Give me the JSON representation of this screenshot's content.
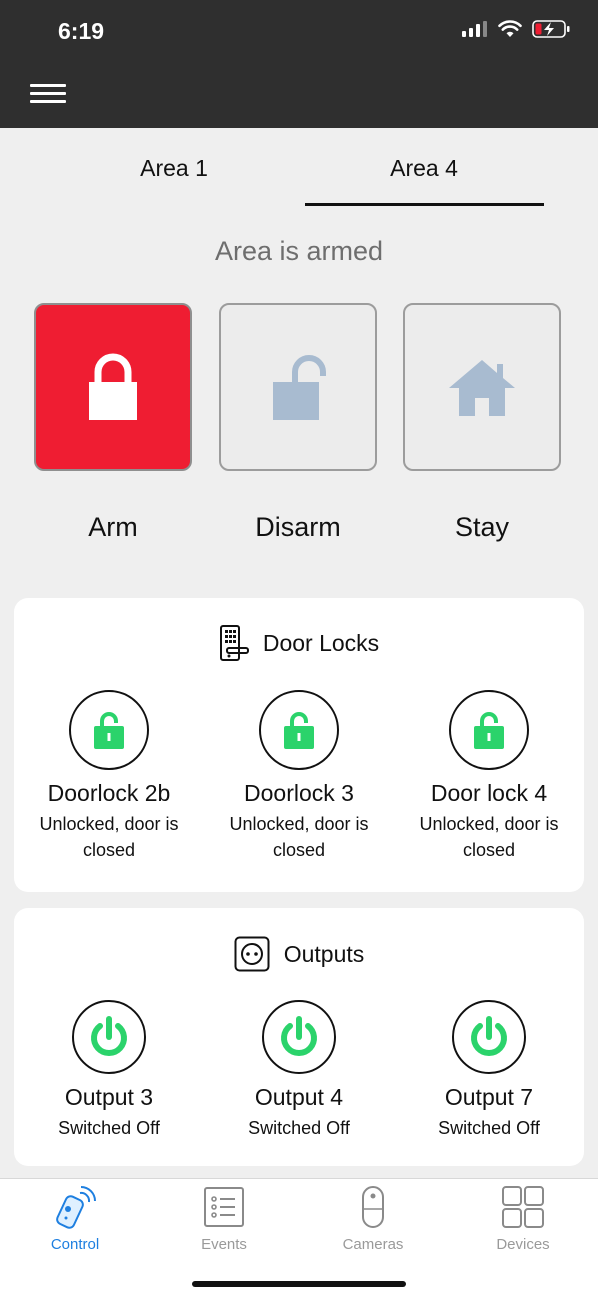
{
  "status_bar": {
    "time": "6:19"
  },
  "tabs": [
    {
      "label": "Area 1",
      "selected": false
    },
    {
      "label": "Area 4",
      "selected": true
    }
  ],
  "area_status": "Area is armed",
  "modes": [
    {
      "label": "Arm",
      "icon": "locked-padlock-icon",
      "active": true
    },
    {
      "label": "Disarm",
      "icon": "unlocked-padlock-icon",
      "active": false
    },
    {
      "label": "Stay",
      "icon": "house-icon",
      "active": false
    }
  ],
  "door_locks": {
    "title": "Door Locks",
    "items": [
      {
        "name": "Doorlock 2b",
        "status": "Unlocked, door is closed"
      },
      {
        "name": "Doorlock 3",
        "status": "Unlocked, door is closed"
      },
      {
        "name": "Door lock 4",
        "status": "Unlocked, door is closed"
      }
    ]
  },
  "outputs": {
    "title": "Outputs",
    "items": [
      {
        "name": "Output 3",
        "status": "Switched Off"
      },
      {
        "name": "Output 4",
        "status": "Switched Off"
      },
      {
        "name": "Output 7",
        "status": "Switched Off"
      }
    ]
  },
  "bottom_nav": [
    {
      "label": "Control",
      "icon": "remote-control-icon",
      "active": true
    },
    {
      "label": "Events",
      "icon": "list-icon",
      "active": false
    },
    {
      "label": "Cameras",
      "icon": "camera-icon",
      "active": false
    },
    {
      "label": "Devices",
      "icon": "grid-icon",
      "active": false
    }
  ],
  "colors": {
    "arm_active": "#ef1d32",
    "inactive_icon": "#a8bbd0",
    "unlocked_green": "#2bd36b",
    "nav_active": "#1e7fe0",
    "header_bg": "#2f2f2f"
  }
}
